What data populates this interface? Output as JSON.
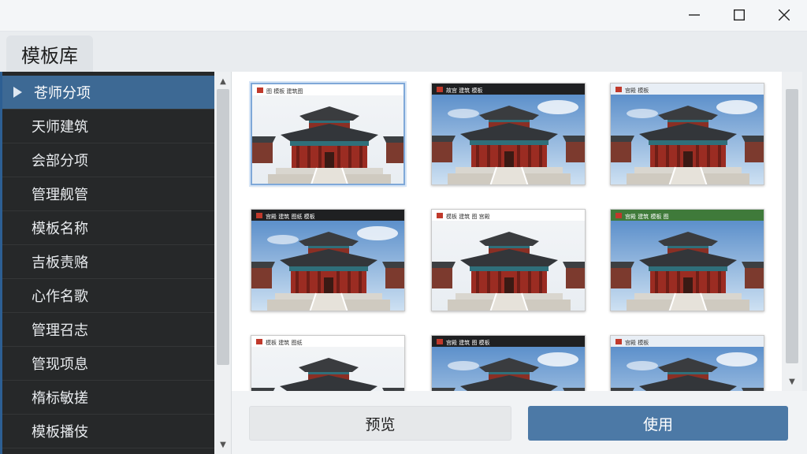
{
  "window": {
    "min_icon": "minimize-icon",
    "max_icon": "maximize-icon",
    "close_icon": "close-icon"
  },
  "header": {
    "title": "模板库"
  },
  "sidebar": {
    "items": [
      {
        "label": "苍师分项",
        "active": true
      },
      {
        "label": "天师建筑"
      },
      {
        "label": "会部分项"
      },
      {
        "label": "管理舰管"
      },
      {
        "label": "模板名称"
      },
      {
        "label": "吉板责赂"
      },
      {
        "label": "心作名歌"
      },
      {
        "label": "管理召志"
      },
      {
        "label": "管现项息"
      },
      {
        "label": "楕标敏搓"
      },
      {
        "label": "模板播伎"
      }
    ]
  },
  "gallery": {
    "thumbnails": [
      {
        "caption": "图 模板 建筑图",
        "style": "white",
        "selected": true
      },
      {
        "caption": "故宫 建筑 模板",
        "style": "dark"
      },
      {
        "caption": "宫殿 模板",
        "style": "blue"
      },
      {
        "caption": "宫殿 建筑 图纸 模板",
        "style": "dark"
      },
      {
        "caption": "模板 建筑 图 宫殿",
        "style": "white"
      },
      {
        "caption": "宫殿 建筑 模板 图",
        "style": "green"
      },
      {
        "caption": "模板 建筑 图纸",
        "style": "white"
      },
      {
        "caption": "宫殿 建筑 图 模板",
        "style": "dark"
      },
      {
        "caption": "宫殿 模板",
        "style": "blue"
      }
    ]
  },
  "footer": {
    "preview_label": "预览",
    "use_label": "使用"
  },
  "colors": {
    "accent": "#4c79a6",
    "sidebar_bg": "#262829",
    "sidebar_active": "#3d6994"
  }
}
